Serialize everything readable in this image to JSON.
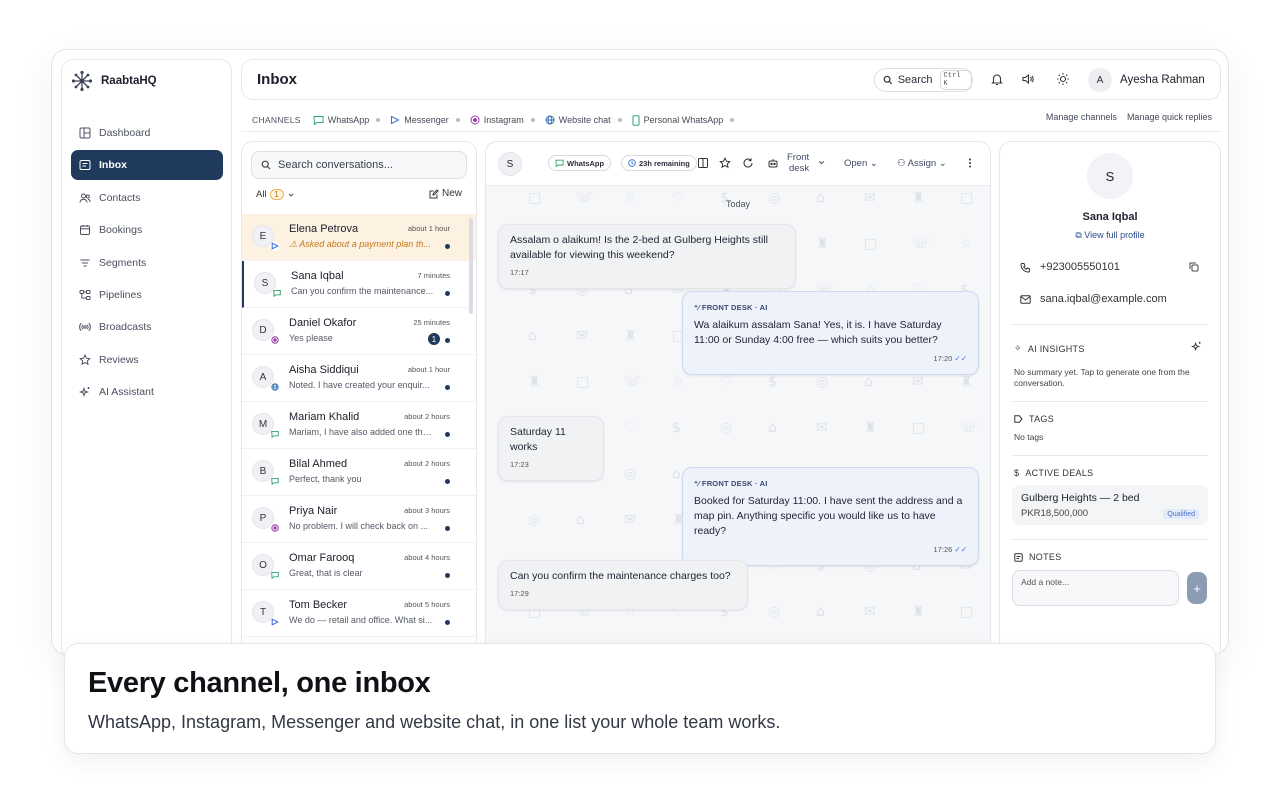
{
  "app": {
    "name": "RaabtaHQ"
  },
  "sidebar": {
    "items": [
      {
        "label": "Dashboard",
        "icon": "dashboard-icon",
        "active": false
      },
      {
        "label": "Inbox",
        "icon": "inbox-icon",
        "active": true
      },
      {
        "label": "Contacts",
        "icon": "contacts-icon",
        "active": false
      },
      {
        "label": "Bookings",
        "icon": "calendar-icon",
        "active": false
      },
      {
        "label": "Segments",
        "icon": "filter-icon",
        "active": false
      },
      {
        "label": "Pipelines",
        "icon": "pipeline-icon",
        "active": false
      },
      {
        "label": "Broadcasts",
        "icon": "broadcast-icon",
        "active": false
      },
      {
        "label": "Reviews",
        "icon": "star-icon",
        "active": false
      },
      {
        "label": "AI Assistant",
        "icon": "sparkle-icon",
        "active": false
      }
    ]
  },
  "header": {
    "title": "Inbox",
    "search_label": "Search",
    "search_shortcut": "Ctrl K",
    "user_initial": "A",
    "user_name": "Ayesha Rahman"
  },
  "channels": {
    "label": "CHANNELS",
    "items": [
      "WhatsApp",
      "Messenger",
      "Instagram",
      "Website chat",
      "Personal WhatsApp"
    ],
    "manage_channels": "Manage channels",
    "manage_quick_replies": "Manage quick replies"
  },
  "conv_list": {
    "search_placeholder": "Search conversations...",
    "filter_label": "All",
    "filter_count": "1",
    "new_label": "New",
    "conversations": [
      {
        "initial": "E",
        "name": "Elena Petrova",
        "time": "about 1 hour",
        "snippet": "⚠ Asked about a payment plan th...",
        "channel": "messenger",
        "highlight": true,
        "selected": false,
        "unread_count": ""
      },
      {
        "initial": "S",
        "name": "Sana Iqbal",
        "time": "7 minutes",
        "snippet": "Can you confirm the maintenance...",
        "channel": "whatsapp",
        "highlight": false,
        "selected": true,
        "unread_count": ""
      },
      {
        "initial": "D",
        "name": "Daniel Okafor",
        "time": "25 minutes",
        "snippet": "Yes please",
        "channel": "instagram",
        "highlight": false,
        "selected": false,
        "unread_count": "1"
      },
      {
        "initial": "A",
        "name": "Aisha Siddiqui",
        "time": "about 1 hour",
        "snippet": "Noted. I have created your enquir...",
        "channel": "website",
        "highlight": false,
        "selected": false,
        "unread_count": ""
      },
      {
        "initial": "M",
        "name": "Mariam Khalid",
        "time": "about 2 hours",
        "snippet": "Mariam, I have also added one tha...",
        "channel": "whatsapp",
        "highlight": false,
        "selected": false,
        "unread_count": ""
      },
      {
        "initial": "B",
        "name": "Bilal Ahmed",
        "time": "about 2 hours",
        "snippet": "Perfect, thank you",
        "channel": "whatsapp",
        "highlight": false,
        "selected": false,
        "unread_count": ""
      },
      {
        "initial": "P",
        "name": "Priya Nair",
        "time": "about 3 hours",
        "snippet": "No problem. I will check back on ...",
        "channel": "instagram",
        "highlight": false,
        "selected": false,
        "unread_count": ""
      },
      {
        "initial": "O",
        "name": "Omar Farooq",
        "time": "about 4 hours",
        "snippet": "Great, that is clear",
        "channel": "whatsapp",
        "highlight": false,
        "selected": false,
        "unread_count": ""
      },
      {
        "initial": "T",
        "name": "Tom Becker",
        "time": "about 5 hours",
        "snippet": "We do — retail and office. What si...",
        "channel": "messenger",
        "highlight": false,
        "selected": false,
        "unread_count": ""
      }
    ]
  },
  "chat": {
    "avatar_initial": "S",
    "channel_pill": "WhatsApp",
    "window_pill": "23h remaining",
    "team_line1": "Front",
    "team_line2": "desk",
    "status_label": "Open",
    "assign_label": "Assign",
    "day_separator": "Today",
    "messages": [
      {
        "direction": "in",
        "text": "Assalam o alaikum! Is the 2-bed at Gulberg Heights still available for viewing this weekend?",
        "time": "17:17",
        "sender": ""
      },
      {
        "direction": "out",
        "sender": "FRONT DESK · AI",
        "text": "Wa alaikum assalam Sana! Yes, it is. I have Saturday 11:00 or Sunday 4:00 free — which suits you better?",
        "time": "17:20"
      },
      {
        "direction": "in",
        "text": "Saturday 11 works",
        "time": "17:23",
        "sender": ""
      },
      {
        "direction": "out",
        "sender": "FRONT DESK · AI",
        "text": "Booked for Saturday 11:00. I have sent the address and a map pin. Anything specific you would like us to have ready?",
        "time": "17:26"
      },
      {
        "direction": "in",
        "text": "Can you confirm the maintenance charges too?",
        "time": "17:29",
        "sender": ""
      }
    ]
  },
  "contact": {
    "initial": "S",
    "name": "Sana Iqbal",
    "profile_link": "View full profile",
    "phone": "+923005550101",
    "email": "sana.iqbal@example.com",
    "ai_title": "AI INSIGHTS",
    "ai_note": "No summary yet. Tap to generate one from the conversation.",
    "tags_title": "TAGS",
    "tags_note": "No tags",
    "deals_title": "ACTIVE DEALS",
    "deal_name": "Gulberg Heights — 2 bed",
    "deal_value": "PKR18,500,000",
    "deal_stage": "Qualified",
    "notes_title": "NOTES",
    "note_placeholder": "Add a note...",
    "note_add": "+"
  },
  "caption": {
    "title": "Every channel, one inbox",
    "subtitle": "WhatsApp, Instagram, Messenger and website chat, in one list your whole team works."
  },
  "colors": {
    "brand_navy": "#1f3a5c",
    "highlight_bg": "#fdf1e1",
    "warning": "#c7781a",
    "outgoing_bubble": "#eef2fb"
  }
}
